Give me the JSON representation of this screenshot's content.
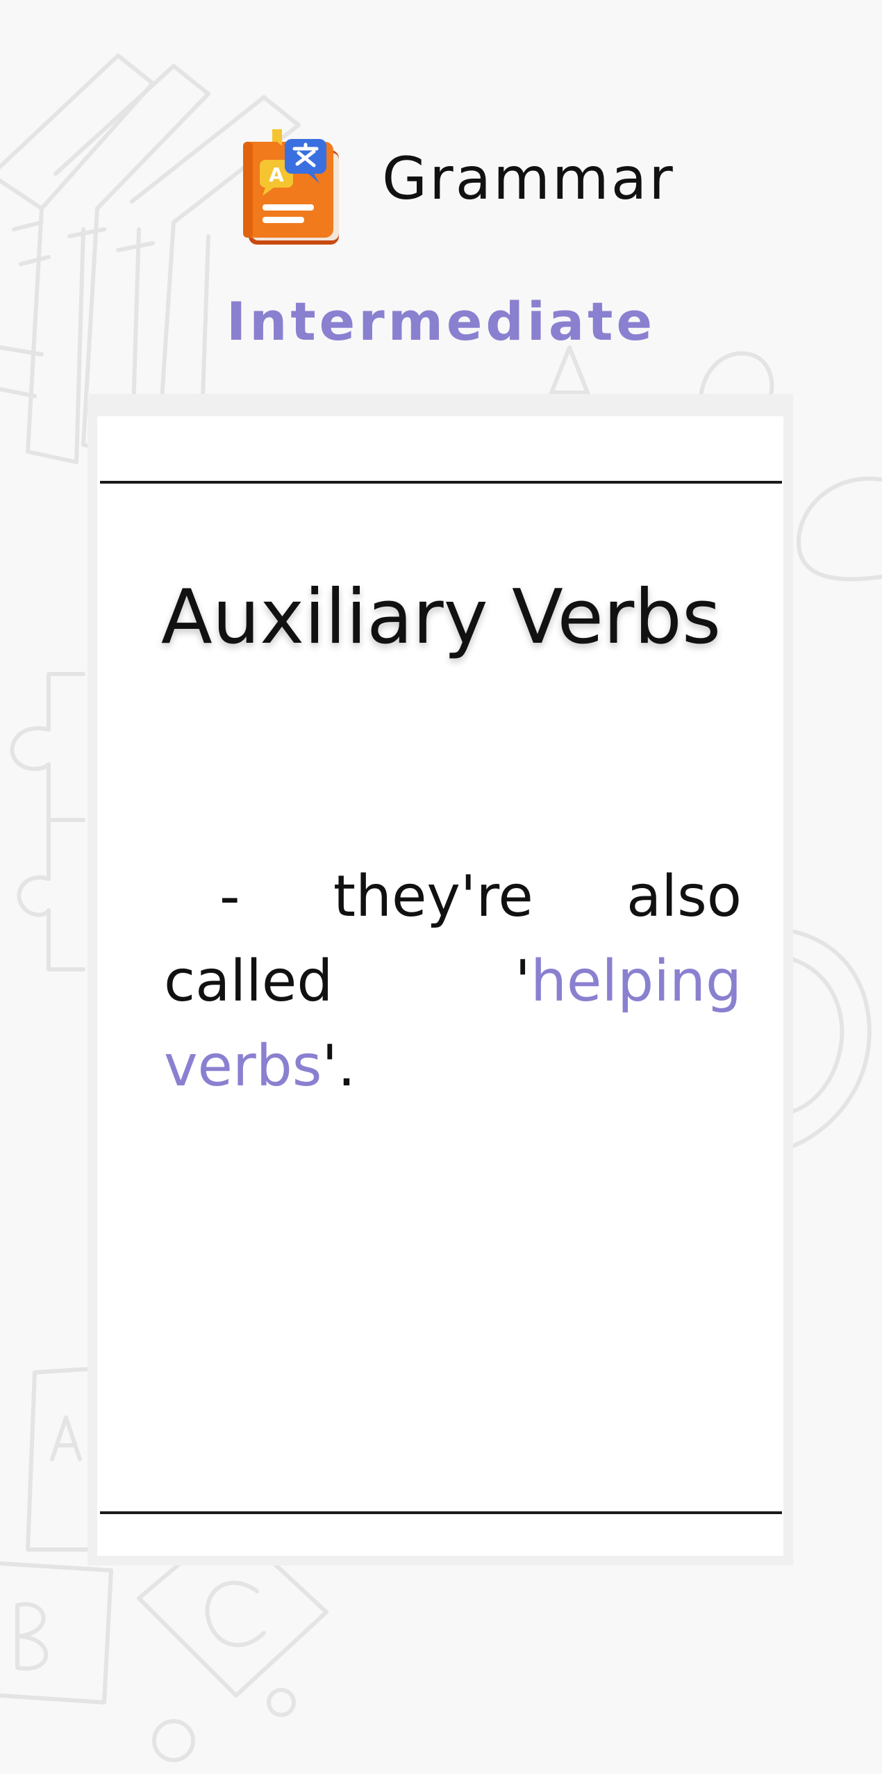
{
  "header": {
    "title": "Grammar",
    "level": "Intermediate",
    "logo_icon": "grammar-book-translate-icon"
  },
  "card": {
    "title": "Auxiliary Verbs",
    "body": {
      "dash": "-",
      "part1": "they're also called '",
      "highlight": "helping verbs",
      "part2": "'."
    }
  },
  "colors": {
    "accent": "#8a80d0",
    "text": "#111111",
    "background": "#f8f8f8",
    "card_border": "#f0f0f0",
    "logo_orange": "#f07a1c",
    "logo_blue": "#3a6fe0",
    "logo_yellow": "#f5c431"
  }
}
